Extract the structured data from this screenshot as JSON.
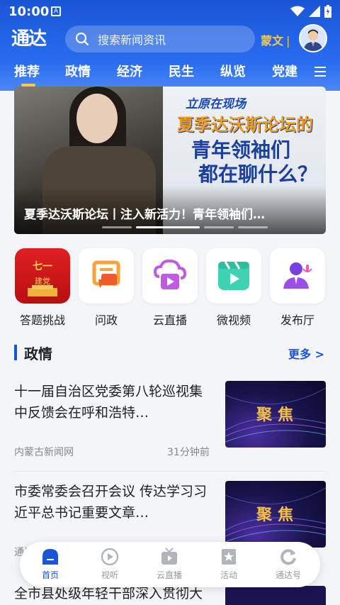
{
  "status_bar": {
    "time": "10:00",
    "notification_glyph": "A"
  },
  "header": {
    "logo_text": "通达",
    "search_placeholder": "搜索新闻资讯",
    "language_label": "蒙文",
    "language_separator": "|"
  },
  "nav_tabs": [
    {
      "label": "推荐",
      "active": true
    },
    {
      "label": "政情",
      "active": false
    },
    {
      "label": "经济",
      "active": false
    },
    {
      "label": "民生",
      "active": false
    },
    {
      "label": "纵览",
      "active": false
    },
    {
      "label": "党建",
      "active": false
    }
  ],
  "banner": {
    "tag": "立原在现场",
    "headline_line1": "夏季达沃斯论坛的",
    "headline_line2": "青年领袖们",
    "headline_line3": "都在聊什么？",
    "caption": "夏季达沃斯论坛丨注入新活力！青年领袖们…",
    "slide_count": 4,
    "active_slide": 2
  },
  "quick_links": [
    {
      "label": "答题挑战",
      "icon": "quiz-challenge-icon",
      "badge_text": "七一建党"
    },
    {
      "label": "问政",
      "icon": "inquiry-icon"
    },
    {
      "label": "云直播",
      "icon": "cloud-live-icon"
    },
    {
      "label": "微视频",
      "icon": "micro-video-icon"
    },
    {
      "label": "发布厅",
      "icon": "press-hall-icon"
    }
  ],
  "section": {
    "title": "政情",
    "more_label": "更多 >"
  },
  "news": [
    {
      "title": "十一届自治区党委第八轮巡视集中反馈会在呼和浩特…",
      "source": "内蒙古新闻网",
      "time": "31分钟前",
      "thumb_text": "聚焦"
    },
    {
      "title": "市委常委会召开会议 传达学习习近平总书记重要文章…",
      "source": "通达新闻",
      "time": "",
      "thumb_text": "聚焦"
    },
    {
      "title": "全市县处级年轻干部深入贯彻大力收听提问情况",
      "source": "",
      "time": "",
      "thumb_text": ""
    }
  ],
  "bottom_nav": [
    {
      "label": "首页",
      "icon": "home-icon",
      "active": true
    },
    {
      "label": "视听",
      "icon": "play-icon",
      "active": false
    },
    {
      "label": "云直播",
      "icon": "tv-icon",
      "active": false
    },
    {
      "label": "活动",
      "icon": "star-icon",
      "active": false
    },
    {
      "label": "通达号",
      "icon": "refresh-icon",
      "active": false
    }
  ],
  "colors": {
    "header_blue": "#1a55d6",
    "accent_gold": "#f2c94c",
    "background": "#f3f5f9"
  }
}
